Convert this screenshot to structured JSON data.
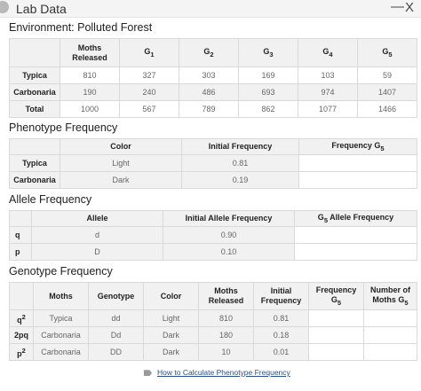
{
  "window": {
    "title": "Lab Data",
    "minimize": "—",
    "close": "X"
  },
  "environment": "Environment: Polluted Forest",
  "moths": {
    "headers": [
      "",
      "Moths Released",
      "G1",
      "G2",
      "G3",
      "G4",
      "G5"
    ],
    "rows": [
      [
        "Typica",
        "810",
        "327",
        "303",
        "169",
        "103",
        "59"
      ],
      [
        "Carbonaria",
        "190",
        "240",
        "486",
        "693",
        "974",
        "1407"
      ],
      [
        "Total",
        "1000",
        "567",
        "789",
        "862",
        "1077",
        "1466"
      ]
    ]
  },
  "phenotype": {
    "title": "Phenotype Frequency",
    "headers": [
      "",
      "Color",
      "Initial Frequency",
      "Frequency G5"
    ],
    "rows": [
      [
        "Typica",
        "Light",
        "0.81",
        ""
      ],
      [
        "Carbonaria",
        "Dark",
        "0.19",
        ""
      ]
    ]
  },
  "allele": {
    "title": "Allele Frequency",
    "headers": [
      "",
      "Allele",
      "Initial Allele Frequency",
      "G5 Allele Frequency"
    ],
    "rows": [
      [
        "q",
        "d",
        "0.90",
        ""
      ],
      [
        "p",
        "D",
        "0.10",
        ""
      ]
    ]
  },
  "genotype": {
    "title": "Genotype Frequency",
    "headers": [
      "",
      "Moths",
      "Genotype",
      "Color",
      "Moths Released",
      "Initial Frequency",
      "Frequency G5",
      "Number of Moths G5"
    ],
    "rows": [
      [
        "q2",
        "Typica",
        "dd",
        "Light",
        "810",
        "0.81",
        "",
        ""
      ],
      [
        "2pq",
        "Carbonaria",
        "Dd",
        "Dark",
        "180",
        "0.18",
        "",
        ""
      ],
      [
        "p2",
        "Carbonaria",
        "DD",
        "Dark",
        "10",
        "0.01",
        "",
        ""
      ]
    ]
  },
  "link": {
    "label": "How to Calculate Phenotype Frequency",
    "icon": "tag-icon"
  }
}
